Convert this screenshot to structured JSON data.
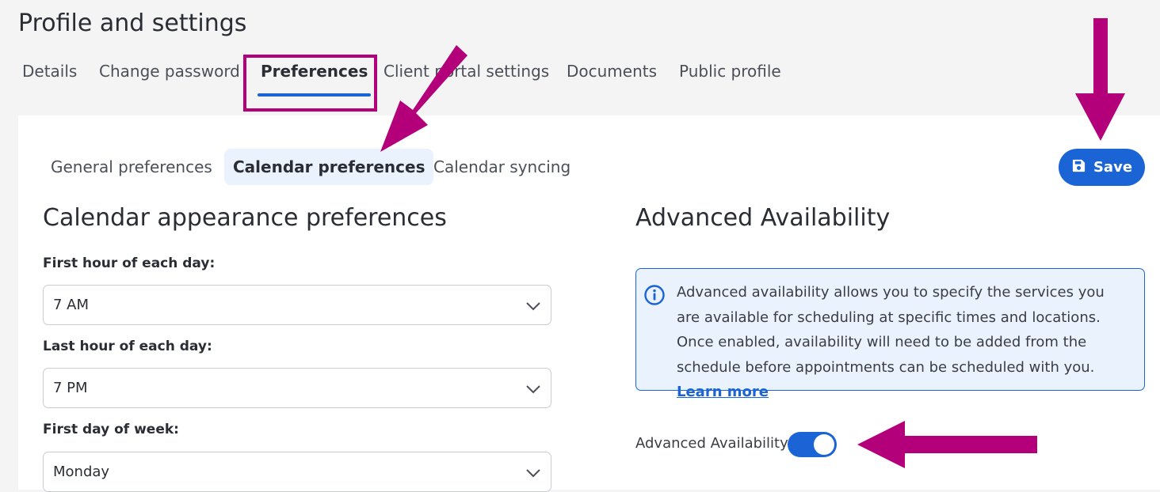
{
  "page": {
    "title": "Profile and settings"
  },
  "top_tabs": [
    {
      "label": "Details"
    },
    {
      "label": "Change password"
    },
    {
      "label": "Preferences",
      "active": true
    },
    {
      "label": "Client portal settings"
    },
    {
      "label": "Documents"
    },
    {
      "label": "Public profile"
    }
  ],
  "sub_tabs": [
    {
      "label": "General preferences"
    },
    {
      "label": "Calendar preferences",
      "active": true
    },
    {
      "label": "Calendar syncing"
    }
  ],
  "save_button": {
    "label": "Save",
    "icon": "floppy-disk-icon"
  },
  "calendar_appearance": {
    "title": "Calendar appearance preferences",
    "fields": [
      {
        "label": "First hour of each day:",
        "value": "7 AM"
      },
      {
        "label": "Last hour of each day:",
        "value": "7 PM"
      },
      {
        "label": "First day of week:",
        "value": "Monday"
      }
    ]
  },
  "advanced_availability": {
    "title": "Advanced Availability",
    "info_icon": "info-circle-icon",
    "info_text": "Advanced availability allows you to specify the services you are available for scheduling at specific times and locations. Once enabled, availability will need to be added from the schedule before appointments can be scheduled with you.",
    "info_link": "Learn more",
    "toggle_label": "Advanced Availability",
    "toggle_on": true
  },
  "colors": {
    "accent": "#1a64d6",
    "annotation": "#b3007a",
    "info_bg": "#eaf2fd",
    "page_bg": "#f4f4f5"
  }
}
